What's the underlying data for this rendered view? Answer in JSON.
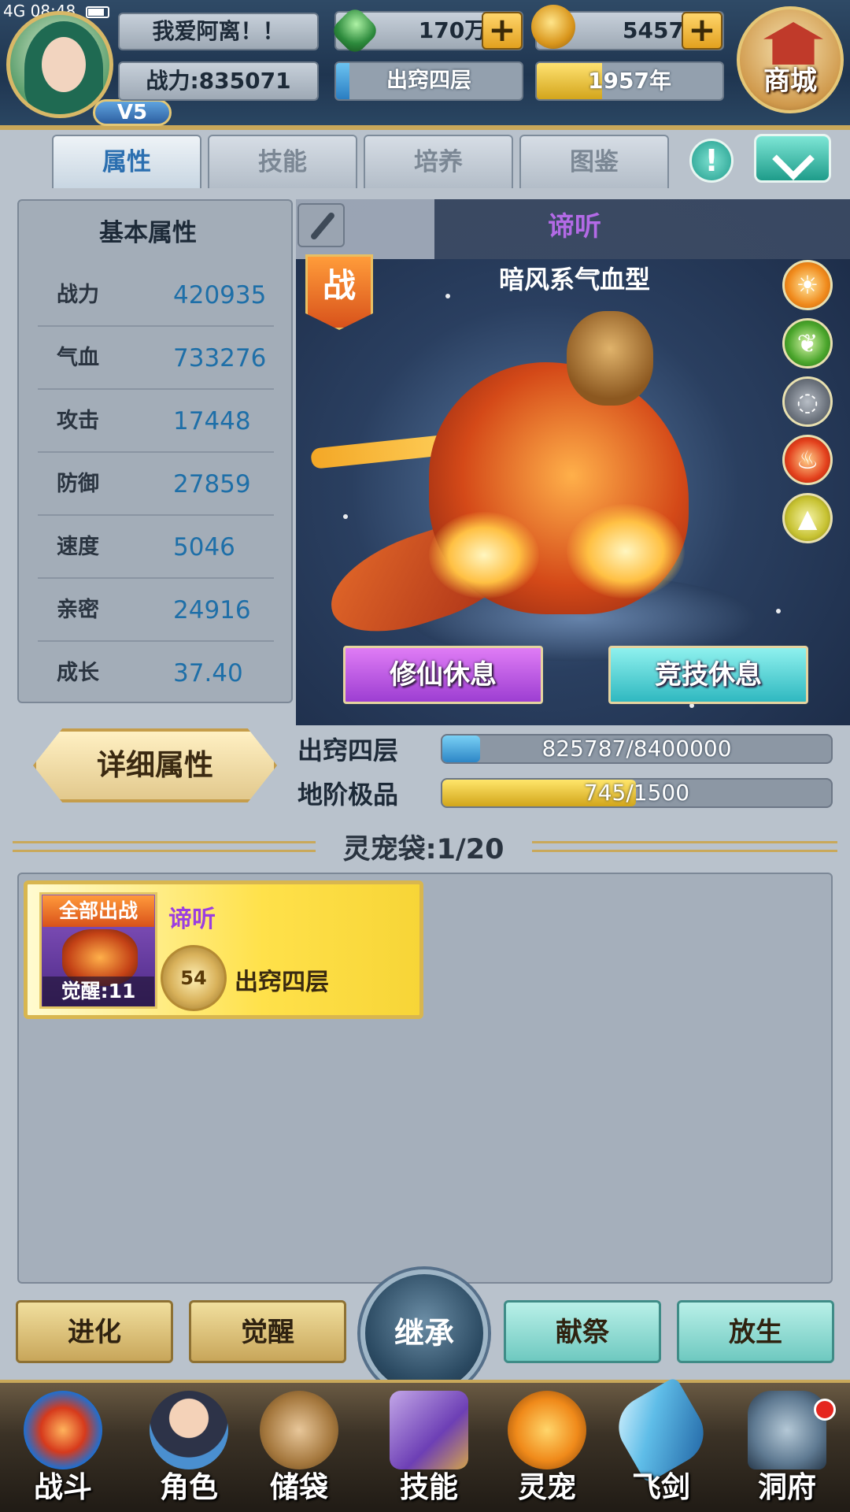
{
  "status_bar": {
    "network": "4G",
    "time": "08:48"
  },
  "player": {
    "name": "我爱阿离！！",
    "power": "战力:835071",
    "vip": "V5",
    "realm": "出窍四层",
    "realm_progress": 0.07,
    "age": "1957年",
    "age_progress": 0.35
  },
  "resources": {
    "gems": "170万",
    "gems_icon": "green-crystal-icon",
    "gold": "5457",
    "gold_icon": "gold-coin-icon",
    "plus": "+"
  },
  "shop": {
    "label": "商城"
  },
  "tabs": [
    {
      "label": "属性",
      "active": true
    },
    {
      "label": "技能",
      "active": false
    },
    {
      "label": "培养",
      "active": false
    },
    {
      "label": "图鉴",
      "active": false
    }
  ],
  "info_button": "!",
  "stats": {
    "title": "基本属性",
    "rows": [
      {
        "label": "战力",
        "value": "420935"
      },
      {
        "label": "气血",
        "value": "733276"
      },
      {
        "label": "攻击",
        "value": "17448"
      },
      {
        "label": "防御",
        "value": "27859"
      },
      {
        "label": "速度",
        "value": "5046"
      },
      {
        "label": "亲密",
        "value": "24916"
      },
      {
        "label": "成长",
        "value": "37.40"
      }
    ],
    "detail_button": "详细属性"
  },
  "pet": {
    "name": "谛听",
    "type": "暗风系气血型",
    "battle_badge": "战",
    "elements": [
      "sun-element-icon",
      "leaf-element-icon",
      "water-element-icon",
      "fire-element-icon",
      "earth-element-icon"
    ],
    "element_glyphs": [
      "☀",
      "❦",
      "◌",
      "♨",
      "▲"
    ],
    "rest_cultivate": "修仙休息",
    "rest_arena": "竞技休息",
    "exp_label": "出窍四层",
    "exp_text": "825787/8400000",
    "exp_fraction": 0.098,
    "grade_label": "地阶极品",
    "grade_text": "745/1500",
    "grade_fraction": 0.497
  },
  "bag": {
    "title": "灵宠袋:1/20",
    "cards": [
      {
        "tag": "全部出战",
        "name": "谛听",
        "awaken": "觉醒:11",
        "level": "54",
        "realm": "出窍四层"
      }
    ]
  },
  "actions": {
    "evolve": "进化",
    "awaken": "觉醒",
    "inherit": "继承",
    "offer": "献祭",
    "release": "放生"
  },
  "nav": [
    {
      "label": "战斗",
      "icon": "battle-icon"
    },
    {
      "label": "角色",
      "icon": "character-icon"
    },
    {
      "label": "储袋",
      "icon": "bag-icon"
    },
    {
      "label": "技能",
      "icon": "skill-scroll-icon"
    },
    {
      "label": "灵宠",
      "icon": "pet-icon"
    },
    {
      "label": "飞剑",
      "icon": "flying-sword-icon"
    },
    {
      "label": "洞府",
      "icon": "cave-mansion-icon"
    }
  ]
}
